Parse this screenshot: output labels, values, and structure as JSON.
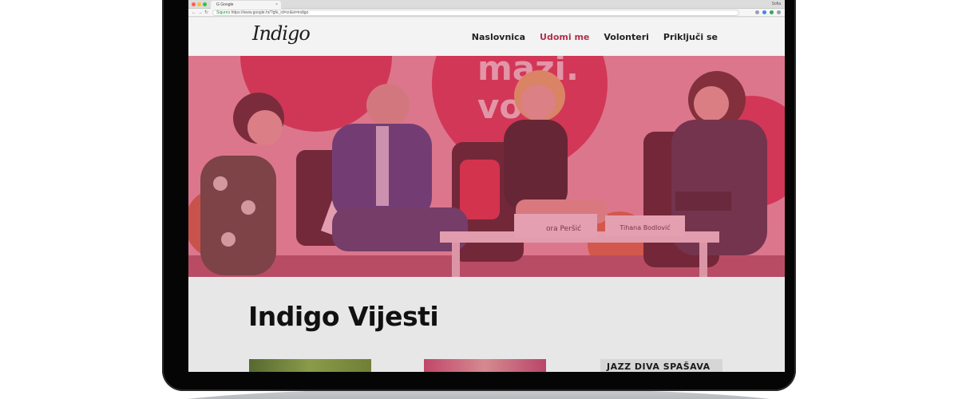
{
  "browser": {
    "tab_title": "G Google",
    "tab_close": "×",
    "user_label": "Sofia",
    "address_secure": "Sigurno",
    "address_url": "https://www.google.hr/?gfe_rd=cr&ei=indigo",
    "back_glyph": "←",
    "forward_glyph": "→",
    "reload_glyph": "↻"
  },
  "site": {
    "logo": "Indigo",
    "nav": [
      "Naslovnica",
      "Udomi me",
      "Volonteri",
      "Priključi se"
    ],
    "active_nav_index": 1
  },
  "hero": {
    "wall_text_1": "mazi.",
    "wall_text_2": "vo",
    "name_card_1": "ora Peršić",
    "name_card_2": "Tihana Bodlović"
  },
  "news": {
    "title": "Indigo Vijesti",
    "thumb_3_headline": "JAZZ DIVA SPAŠAVA"
  },
  "colors": {
    "accent": "#b1314f",
    "hero_tint": "#cd3c5f"
  }
}
